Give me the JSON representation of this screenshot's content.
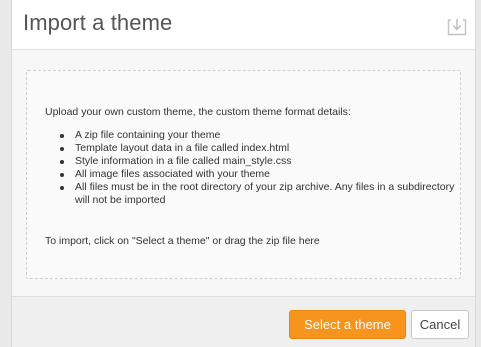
{
  "dialog": {
    "title": "Import a theme",
    "header_icon": "import-icon"
  },
  "body": {
    "intro": "Upload your own custom theme, the custom theme format details:",
    "requirements": [
      "A zip file containing your theme",
      "Template layout data in a file called index.html",
      "Style information in a file called main_style.css",
      "All image files associated with your theme",
      "All files must be in the root directory of your zip archive. Any files in a subdirectory will not be imported"
    ],
    "import_note": "To import, click on \"Select a theme\" or drag the zip file here"
  },
  "footer": {
    "select_label": "Select a theme",
    "cancel_label": "Cancel"
  },
  "colors": {
    "accent": "#f7941d",
    "title_text": "#555555",
    "body_text": "#333333"
  }
}
